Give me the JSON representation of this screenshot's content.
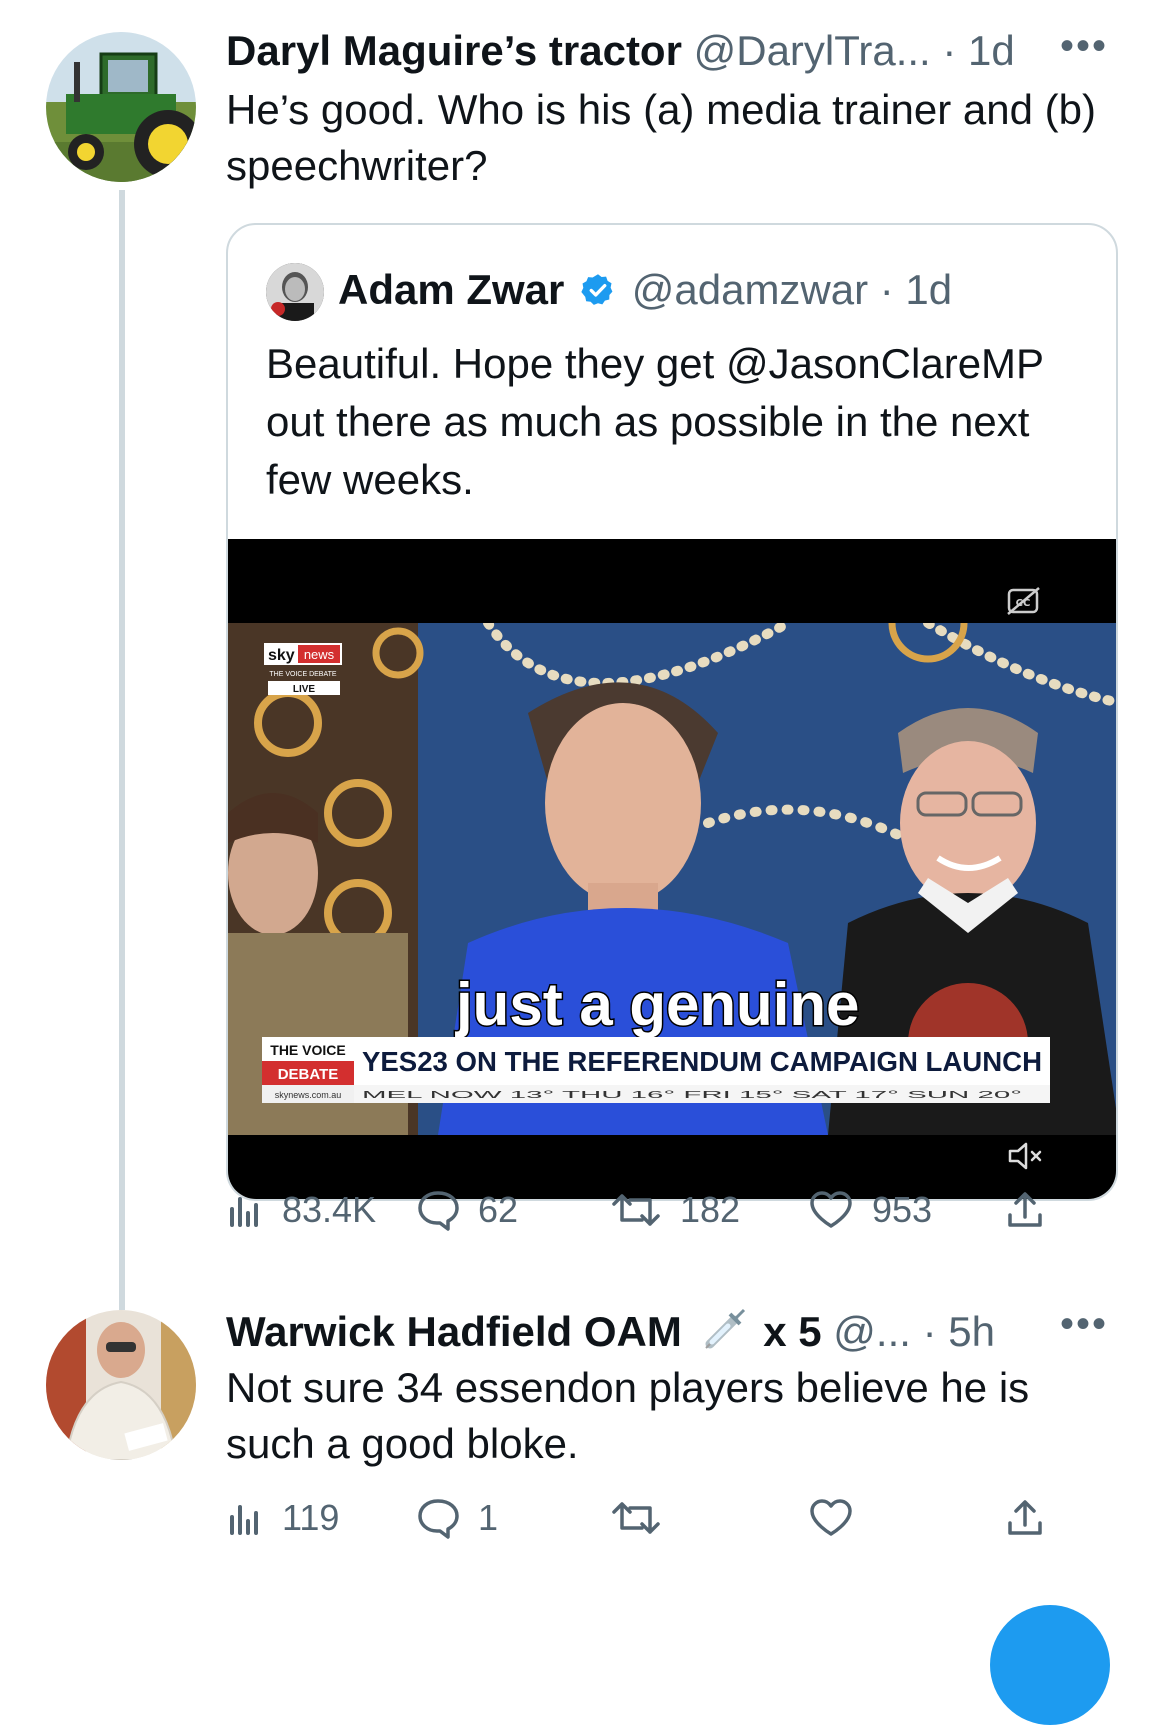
{
  "tweet1": {
    "name": "Daryl Maguire’s tractor",
    "handle": "@DarylTra...",
    "time": "· 1d",
    "text": "He’s good. Who is his (a) media trainer and (b) speechwriter?",
    "quote": {
      "name": "Adam Zwar",
      "handle": "@adamzwar",
      "time": "· 1d",
      "text": "Beautiful. Hope they get @JasonClareMP out there as much as possible in the next few weeks.",
      "video": {
        "caption": "just a genuine",
        "ticker_brand_top": "THE VOICE",
        "ticker_brand_bottom": "DEBATE",
        "ticker_headline": "YES23 ON THE REFERENDUM CAMPAIGN LAUNCH",
        "ticker_site": "skynews.com.au",
        "weather": "MEL NOW 13°  THU  16°  FRI  15°  SAT  17°  SUN  20°",
        "logo_sky": "sky",
        "logo_news": "news",
        "logo_sub": "THE VOICE DEBATE",
        "logo_live": "LIVE",
        "cc_label": "CC"
      }
    },
    "stats": {
      "views": "83.4K",
      "replies": "62",
      "retweets": "182",
      "likes": "953"
    }
  },
  "tweet2": {
    "name": "Warwick Hadfield OAM",
    "name_suffix": "x 5",
    "handle": "@...",
    "time": "· 5h",
    "text": "Not sure 34 essendon players believe he is such a good bloke.",
    "stats": {
      "views": "119",
      "replies": "1",
      "retweets": "",
      "likes": ""
    }
  },
  "icons": {
    "more": "more-horizontal-icon",
    "verified": "verified-badge-icon",
    "views": "bar-chart-icon",
    "reply": "speech-bubble-icon",
    "retweet": "retweet-icon",
    "like": "heart-icon",
    "share": "share-upload-icon",
    "mute": "speaker-muted-icon",
    "captions": "closed-captions-off-icon",
    "syringe": "syringe-emoji-icon"
  },
  "colors": {
    "accent": "#1d9bf0",
    "muted": "#536471",
    "border": "#cfd9de"
  }
}
